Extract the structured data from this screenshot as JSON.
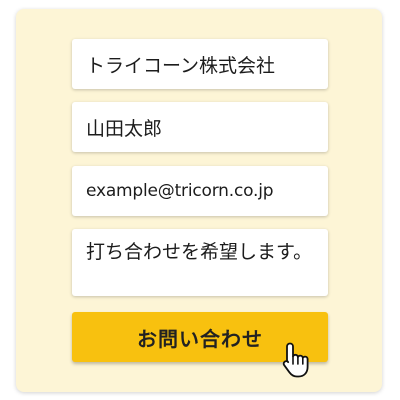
{
  "form": {
    "company_value": "トライコーン株式会社",
    "name_value": "山田太郎",
    "email_value": "example@tricorn.co.jp",
    "message_value": "打ち合わせを希望します。",
    "submit_label": "お問い合わせ"
  },
  "colors": {
    "panel_background": "#fdf5d6",
    "button_background": "#f8c10f",
    "field_background": "#ffffff"
  },
  "icons": {
    "cursor": "hand-pointer-icon"
  }
}
